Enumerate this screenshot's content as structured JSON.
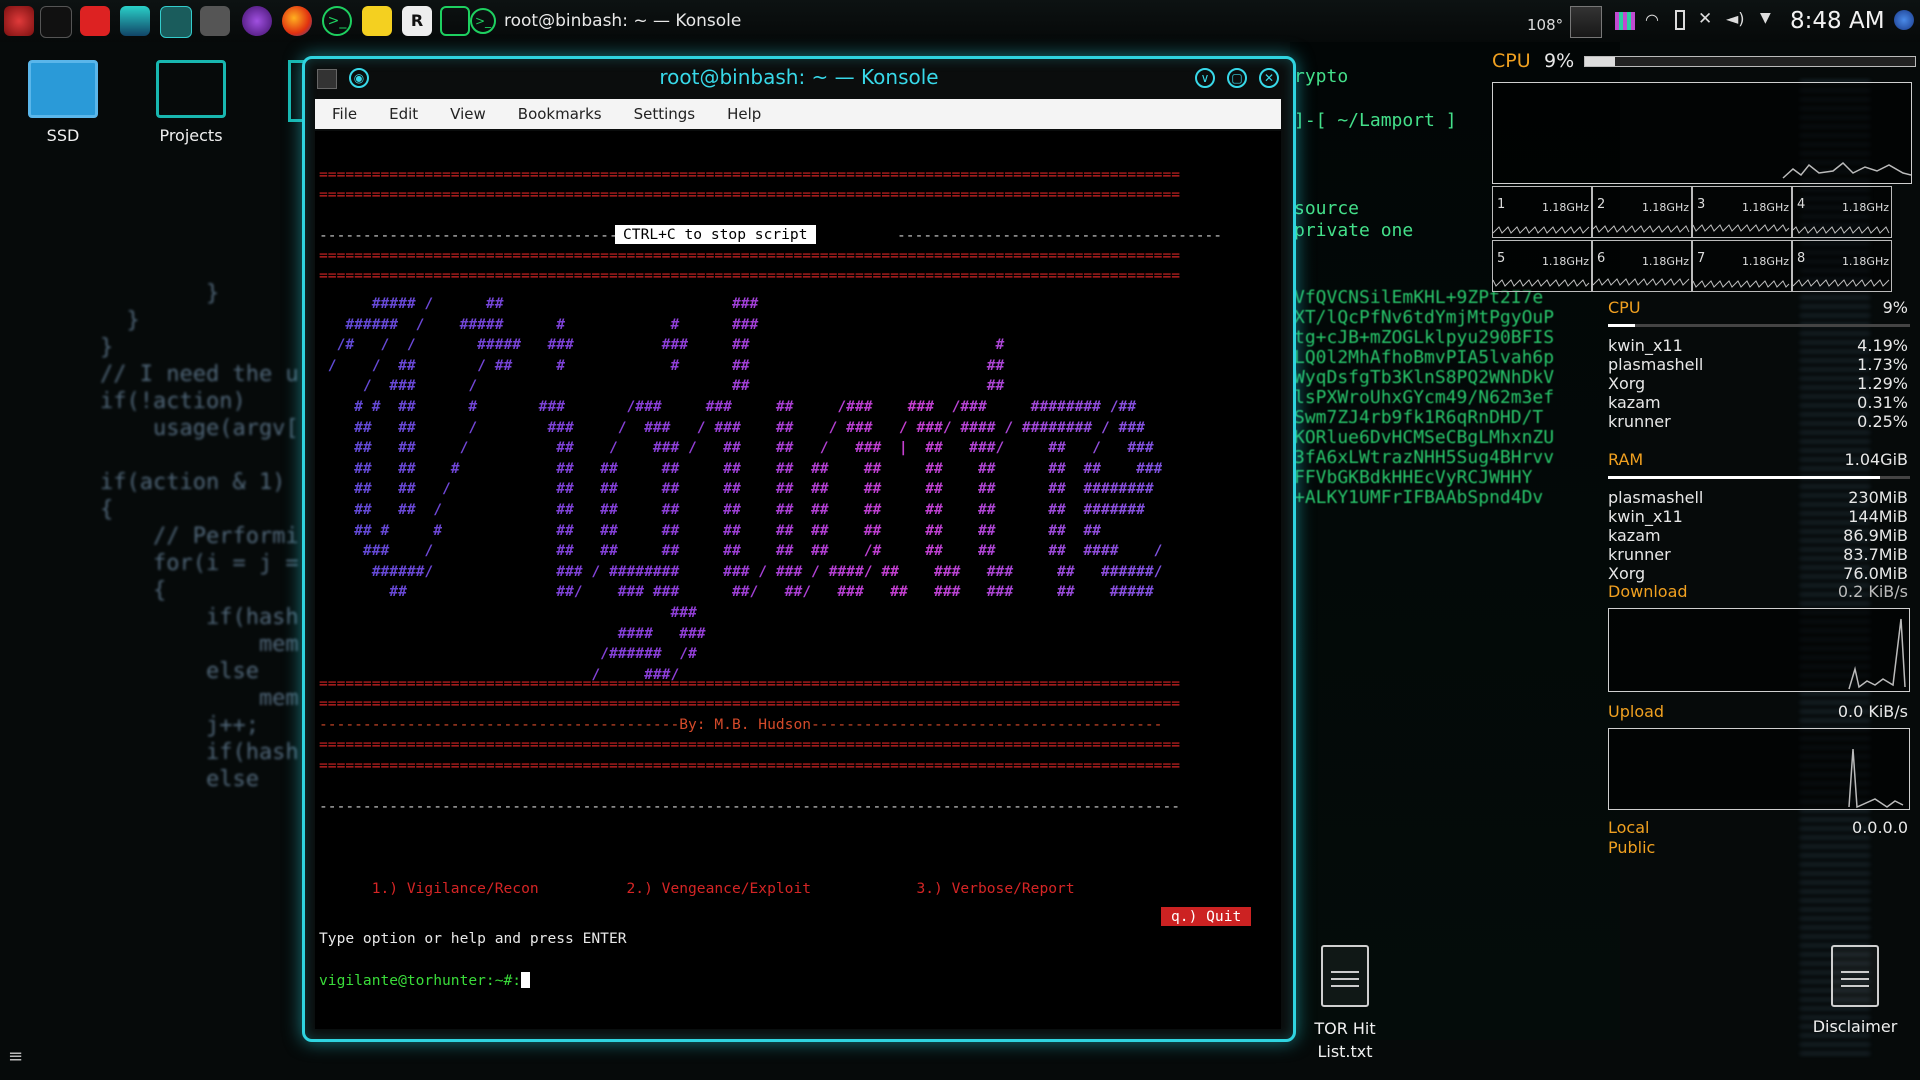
{
  "panel": {
    "window_title": "root@binbash: ~ — Konsole",
    "temperature": "108°",
    "clock": "8:48 AM",
    "launcher_icons": [
      "app-launcher-icon",
      "hacker-icon",
      "folder-icon",
      "anime-icon",
      "system-monitor-icon",
      "media-icon",
      "tor-browser-icon",
      "firefox-icon",
      "terminal-icon",
      "pikachu-icon",
      "r-icon",
      "home-icon"
    ]
  },
  "desktop": {
    "icons": [
      {
        "label": "SSD"
      },
      {
        "label": "Projects"
      },
      {
        "label": "TOR Hit List.txt"
      },
      {
        "label": "Disclaimer"
      }
    ]
  },
  "background": {
    "code": "        }\n  }\n}\n// I need the u\nif(!action)\n    usage(argv[\n\nif(action & 1)\n{\n    // Performi\n    for(i = j =\n    {\n        if(hash\n            mem\n        else\n            mem\n        j++;\n        if(hash\n        else\n",
    "term": "rypto\n\n]-[ ~/Lamport ]\n\n\n\nsource\nprivate one",
    "green": "VfQVCNSilEmKHL+9ZPt2I7e\nXT/lQcPfNv6tdYmjMtPgyOuP\ntg+cJB+mZOGLklpyu290BFIS\nLQ0l2MhAfhoBmvPIA5lvah6p\nWyqDsfgTb3KlnS8PQ2WNhDkV\nlsPXWroUhxGYcm49/N62m3ef\nSwm7ZJ4rb9fk1R6qRnDHD/T\nKORlue6DvHCMSeCBgLMhxnZU\n3fA6xLWtrazNHH5Sug4BHrvv\nFFVbGKBdkHHEcVyRCJWHHY\n+ALKY1UMFrIFBAAbSpnd4Dv"
  },
  "konsole": {
    "title": "root@binbash: ~ — Konsole",
    "menu": [
      "File",
      "Edit",
      "View",
      "Bookmarks",
      "Settings",
      "Help"
    ],
    "terminal": {
      "sep_eq": "==================================================================================================",
      "sep_dash": "--------------------------------------------------------------------------------------------------",
      "stop_left": "-------------------------------------",
      "stop_text": "CTRL+C to stop script",
      "stop_right": "-------------------------------------",
      "art": "      ##### /      ##                          ###\n   ######  /    #####      #            #      ###\n  /#   /  /       #####   ###          ###     ##                            #\n /    /  ##       / ##     #            #      ##                           ##\n     /  ###      /                             ##                           ##\n    # #  ##      #       ###       /###     ###     ##     /###    ###  /###     ######## /##\n    ##   ##      /        ###     /  ###   / ###    ##    / ###   / ###/ #### / ######## / ###\n    ##   ##     /          ##    /    ### /   ##    ##   /   ###  |  ##   ###/     ##   /   ###\n    ##   ##    #           ##   ##     ##     ##    ##  ##    ##     ##    ##      ##  ##    ###\n    ##   ##   /            ##   ##     ##     ##    ##  ##    ##     ##    ##      ##  ########\n    ##   ##  /             ##   ##     ##     ##    ##  ##    ##     ##    ##      ##  #######\n    ## #     #             ##   ##     ##     ##    ##  ##    ##     ##    ##      ##  ##\n     ###    /              ##   ##     ##     ##    ##  ##    /#     ##    ##      ##  ####    /\n      ######/              ### / ########     ### / ### / ####/ ##    ###   ###     ##   ######/\n        ##                 ##/    ### ###      ##/   ##/   ###   ##   ###   ###     ##    #####\n                                        ###\n                                  ####   ###\n                                /######  /#\n                               /     ###/",
      "byline": "-----------------------------------------By: M.B. Hudson----------------------------------------",
      "options": "      1.) Vigilance/Recon          2.) Vengeance/Exploit            3.) Verbose/Report",
      "quit": "q.) Quit",
      "instruction": "Type option or help and press ENTER",
      "prompt": "vigilante@torhunter:~#:"
    }
  },
  "widgets": {
    "cpu_header": {
      "label": "CPU",
      "value": "9%",
      "fill": 0.09
    },
    "cores": [
      {
        "n": "1",
        "freq": "1.18GHz"
      },
      {
        "n": "2",
        "freq": "1.18GHz"
      },
      {
        "n": "3",
        "freq": "1.18GHz"
      },
      {
        "n": "4",
        "freq": "1.18GHz"
      },
      {
        "n": "5",
        "freq": "1.18GHz"
      },
      {
        "n": "6",
        "freq": "1.18GHz"
      },
      {
        "n": "7",
        "freq": "1.18GHz"
      },
      {
        "n": "8",
        "freq": "1.18GHz"
      }
    ],
    "cpu": {
      "label": "CPU",
      "value": "9%",
      "fill": 0.09,
      "procs": [
        {
          "name": "kwin_x11",
          "val": "4.19%"
        },
        {
          "name": "plasmashell",
          "val": "1.73%"
        },
        {
          "name": "Xorg",
          "val": "1.29%"
        },
        {
          "name": "kazam",
          "val": "0.31%"
        },
        {
          "name": "krunner",
          "val": "0.25%"
        }
      ]
    },
    "ram": {
      "label": "RAM",
      "value": "1.04GiB",
      "fill": 0.9,
      "procs": [
        {
          "name": "plasmashell",
          "val": "230MiB"
        },
        {
          "name": "kwin_x11",
          "val": "144MiB"
        },
        {
          "name": "kazam",
          "val": "86.9MiB"
        },
        {
          "name": "krunner",
          "val": "83.7MiB"
        },
        {
          "name": "Xorg",
          "val": "76.0MiB"
        }
      ]
    },
    "download": {
      "label": "Download",
      "value": "0.2 KiB/s"
    },
    "upload": {
      "label": "Upload",
      "value": "0.0 KiB/s"
    },
    "ip": {
      "local": "Local",
      "public": "Public",
      "value": "0.0.0.0"
    },
    "colors": {
      "accent": "#2fd4e0",
      "orange": "#f0a020",
      "term_red": "#d52525",
      "prompt_green": "#3adc3a"
    }
  }
}
